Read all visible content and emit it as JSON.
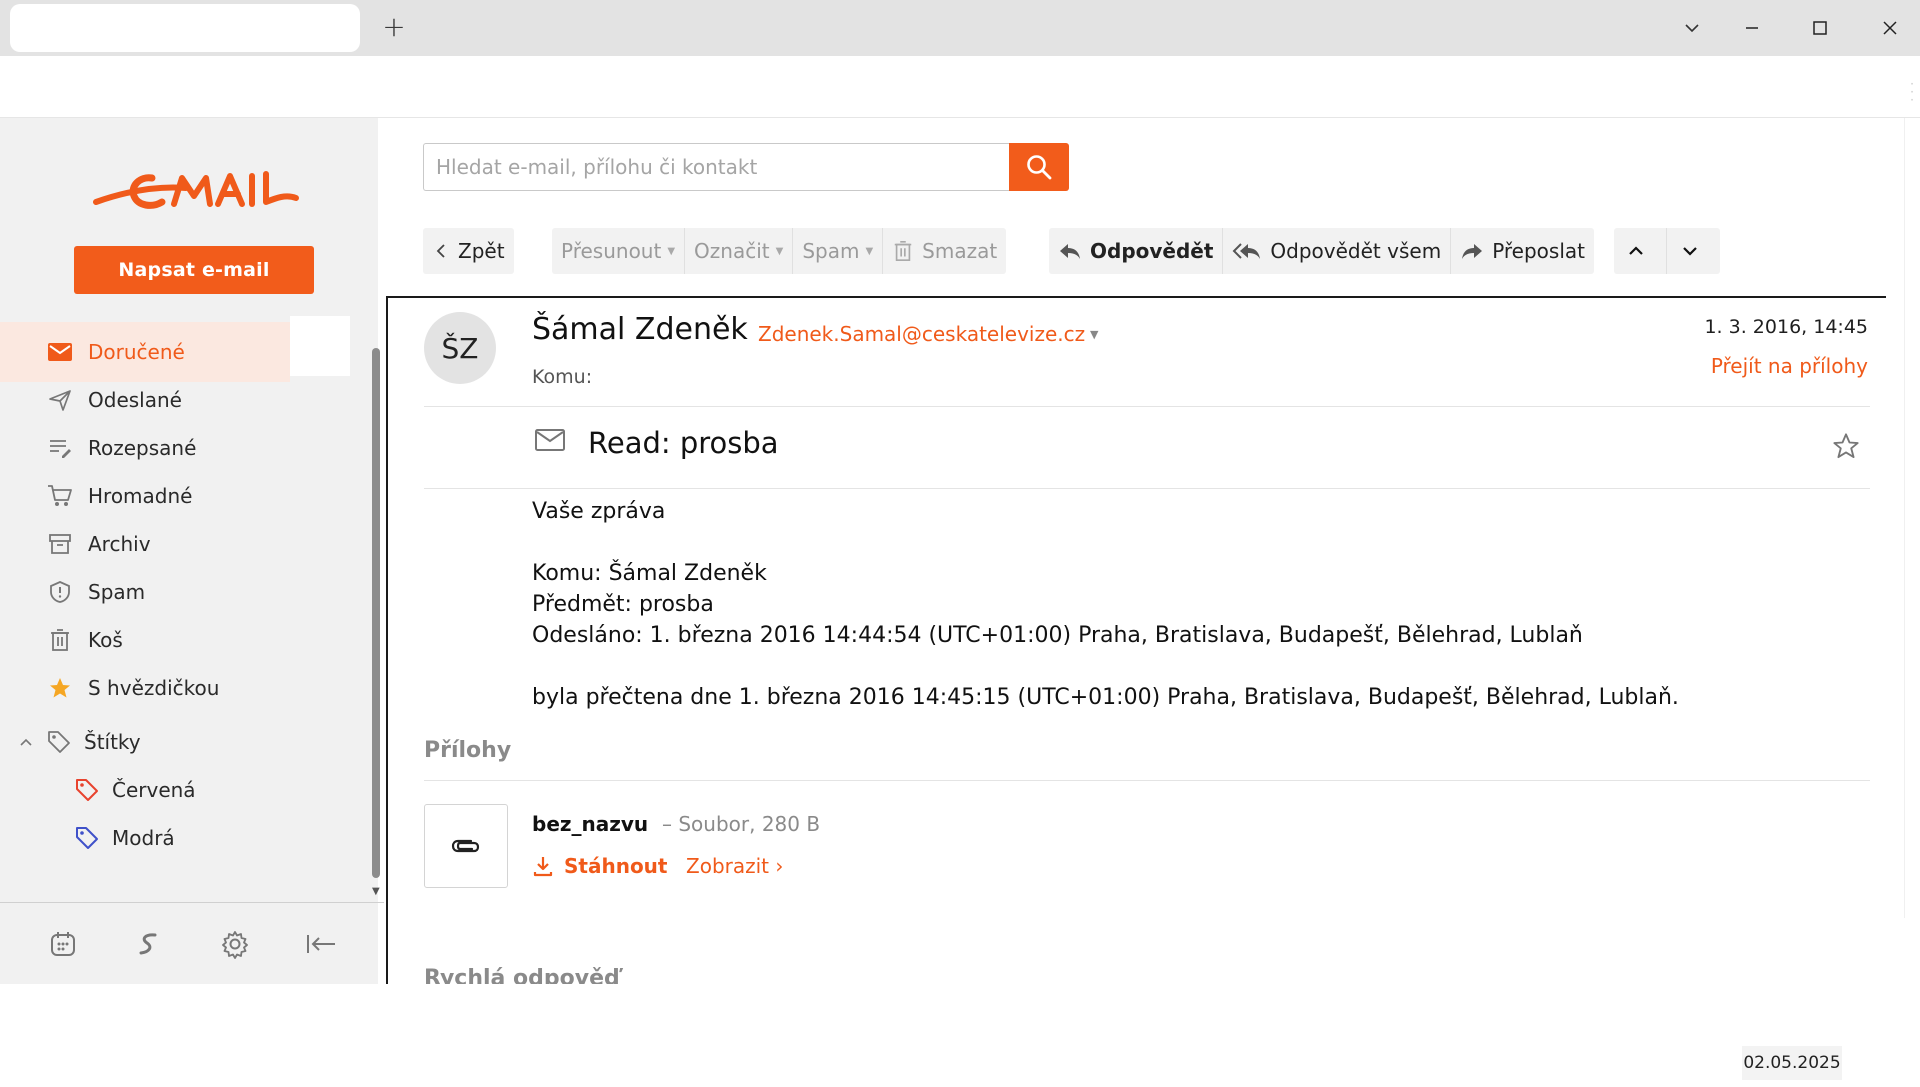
{
  "browser": {
    "new_tab": "+"
  },
  "sidebar": {
    "compose_label": "Napsat e-mail",
    "folders": [
      {
        "label": "Doručené",
        "icon": "inbox-icon",
        "active": true
      },
      {
        "label": "Odeslané",
        "icon": "send-icon"
      },
      {
        "label": "Rozepsané",
        "icon": "draft-icon"
      },
      {
        "label": "Hromadné",
        "icon": "cart-icon"
      },
      {
        "label": "Archiv",
        "icon": "archive-icon"
      },
      {
        "label": "Spam",
        "icon": "shield-icon"
      },
      {
        "label": "Koš",
        "icon": "trash-icon"
      },
      {
        "label": "S hvězdičkou",
        "icon": "star-icon"
      }
    ],
    "labels_heading": "Štítky",
    "labels": [
      {
        "label": "Červená",
        "color": "#e8432e"
      },
      {
        "label": "Modrá",
        "color": "#3f51c9"
      }
    ]
  },
  "search": {
    "placeholder": "Hledat e-mail, přílohu či kontakt"
  },
  "toolbar": {
    "back": "Zpět",
    "move": "Přesunout",
    "mark": "Označit",
    "spam": "Spam",
    "delete": "Smazat",
    "reply": "Odpovědět",
    "reply_all": "Odpovědět všem",
    "forward": "Přeposlat"
  },
  "message": {
    "avatar_initials": "ŠZ",
    "sender_name": "Šámal Zdeněk",
    "sender_email": "Zdenek.Samal@ceskatelevize.cz",
    "to_label": "Komu:",
    "date": "1. 3. 2016, 14:45",
    "goto_attachments": "Přejít na přílohy",
    "subject": "Read: prosba",
    "body": {
      "line1": "Vaše zpráva",
      "line2": "Komu: Šámal Zdeněk",
      "line3": "Předmět: prosba",
      "line4": "Odesláno: 1. března 2016 14:44:54 (UTC+01:00) Praha, Bratislava, Budapešť, Bělehrad, Lublaň",
      "line5": "byla přečtena dne 1. března 2016 14:45:15 (UTC+01:00) Praha, Bratislava, Budapešť, Bělehrad, Lublaň."
    },
    "attachments_heading": "Přílohy",
    "attachment": {
      "name": "bez_nazvu",
      "meta": "– Soubor, 280 B",
      "download": "Stáhnout",
      "view": "Zobrazit ›"
    },
    "quick_reply_heading": "Rychlá odpověď"
  },
  "taskbar": {
    "date": "02.05.2025"
  },
  "colors": {
    "accent": "#f25c1b",
    "sidebar_bg": "#f1f1f1",
    "active_bg": "#fbe8e0"
  }
}
